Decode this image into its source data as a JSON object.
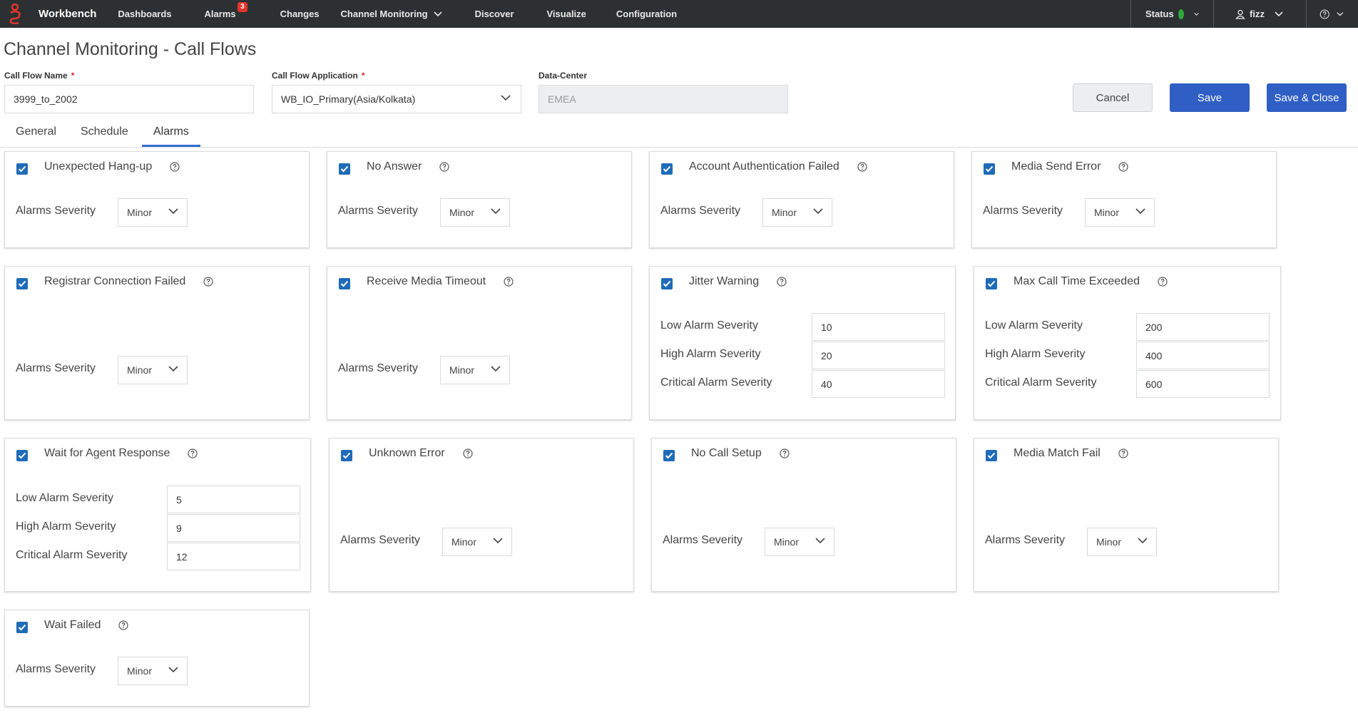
{
  "nav": {
    "brand": "Workbench",
    "items": [
      {
        "label": "Dashboards"
      },
      {
        "label": "Alarms",
        "badge": "3"
      },
      {
        "label": "Changes"
      },
      {
        "label": "Channel Monitoring",
        "has_chevron": true
      },
      {
        "label": "Discover"
      },
      {
        "label": "Visualize"
      },
      {
        "label": "Configuration"
      }
    ],
    "status_label": "Status",
    "user_label": "fizz",
    "status_color": "#2eaa3a"
  },
  "page": {
    "title": "Channel Monitoring - Call Flows"
  },
  "form": {
    "call_flow_name_label": "Call Flow Name",
    "call_flow_name_value": "3999_to_2002",
    "call_flow_app_label": "Call Flow Application",
    "call_flow_app_value": "WB_IO_Primary(Asia/Kolkata)",
    "data_center_label": "Data-Center",
    "data_center_value": "EMEA",
    "required_mark": "*"
  },
  "buttons": {
    "cancel": "Cancel",
    "save": "Save",
    "save_close": "Save & Close"
  },
  "tabs": {
    "general": "General",
    "schedule": "Schedule",
    "alarms": "Alarms"
  },
  "labels": {
    "alarms_severity": "Alarms Severity",
    "low": "Low Alarm Severity",
    "high": "High Alarm Severity",
    "critical": "Critical Alarm Severity"
  },
  "alarms": {
    "unexpected_hangup": {
      "title": "Unexpected Hang-up",
      "severity": "Minor"
    },
    "no_answer": {
      "title": "No Answer",
      "severity": "Minor"
    },
    "account_auth_failed": {
      "title": "Account Authentication Failed",
      "severity": "Minor"
    },
    "media_send_error": {
      "title": "Media Send Error",
      "severity": "Minor"
    },
    "registrar_conn_failed": {
      "title": "Registrar Connection Failed",
      "severity": "Minor"
    },
    "receive_media_timeout": {
      "title": "Receive Media Timeout",
      "severity": "Minor"
    },
    "jitter_warning": {
      "title": "Jitter Warning",
      "low": "10",
      "high": "20",
      "critical": "40"
    },
    "max_call_time": {
      "title": "Max Call Time Exceeded",
      "low": "200",
      "high": "400",
      "critical": "600"
    },
    "wait_agent_response": {
      "title": "Wait for Agent Response",
      "low": "5",
      "high": "9",
      "critical": "12"
    },
    "unknown_error": {
      "title": "Unknown Error",
      "severity": "Minor"
    },
    "no_call_setup": {
      "title": "No Call Setup",
      "severity": "Minor"
    },
    "media_match_fail": {
      "title": "Media Match Fail",
      "severity": "Minor"
    },
    "wait_failed": {
      "title": "Wait Failed",
      "severity": "Minor"
    }
  },
  "icons": {
    "logo": "genesys-logo-icon",
    "checkbox": "checkbox-checked-icon",
    "help": "help-circle-icon",
    "chevron": "chevron-down-icon",
    "user": "user-icon"
  }
}
